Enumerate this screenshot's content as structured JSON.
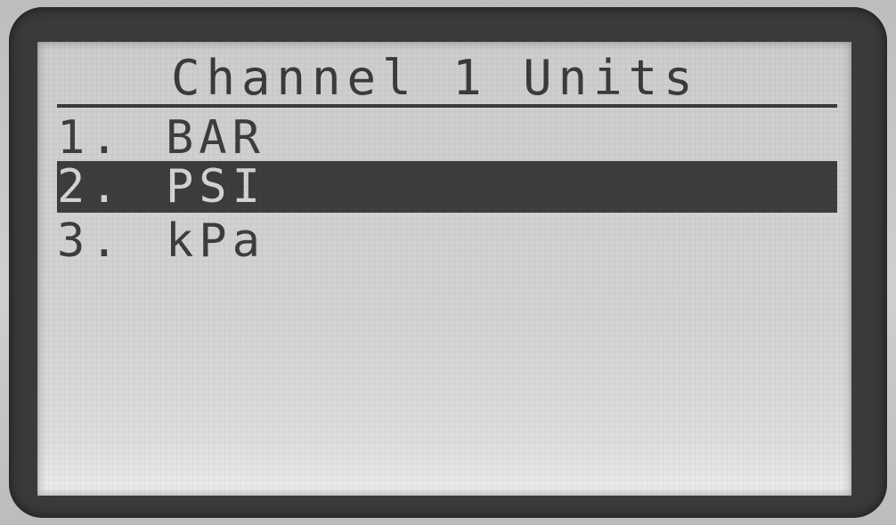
{
  "screen": {
    "title": "Channel 1 Units"
  },
  "menu": {
    "items": [
      {
        "number": "1.",
        "label": "BAR",
        "selected": false
      },
      {
        "number": "2.",
        "label": "PSI",
        "selected": true
      },
      {
        "number": "3.",
        "label": "kPa",
        "selected": false
      }
    ]
  },
  "colors": {
    "lcd_background": "#d0d0d0",
    "lcd_text": "#3b3b3b",
    "highlight_bar": "#3d3d3d",
    "bezel": "#3a3a3a"
  }
}
